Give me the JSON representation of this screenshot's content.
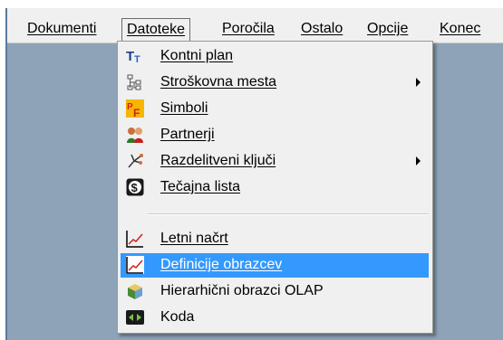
{
  "menubar": {
    "items": [
      {
        "label": "Dokumenti"
      },
      {
        "label": "Datoteke",
        "open": true
      },
      {
        "label": "Poročila"
      },
      {
        "label": "Ostalo"
      },
      {
        "label": "Opcije"
      },
      {
        "label": "Konec"
      }
    ]
  },
  "dropdown": {
    "items": [
      {
        "label": "Kontni plan",
        "icon": "text-tt-icon"
      },
      {
        "label": "Stroškovna mesta",
        "icon": "hierarchy-icon",
        "submenu": true
      },
      {
        "label": "Simboli",
        "icon": "pf-symbols-icon"
      },
      {
        "label": "Partnerji",
        "icon": "partners-icon"
      },
      {
        "label": "Razdelitveni ključi",
        "icon": "distribution-key-icon",
        "submenu": true
      },
      {
        "label": "Tečajna lista",
        "icon": "dollar-icon"
      },
      {
        "label": "Letni načrt",
        "icon": "chart-line-icon"
      },
      {
        "label": "Definicije obrazcev",
        "icon": "chart-line-icon",
        "highlighted": true
      },
      {
        "label": "Hierarhični obrazci OLAP",
        "icon": "olap-cube-icon"
      },
      {
        "label": "Koda",
        "icon": "code-icon"
      }
    ]
  },
  "colors": {
    "highlight": "#3399ff",
    "menu_bg": "#f0f0f0",
    "client_bg": "#8ea3b8"
  }
}
